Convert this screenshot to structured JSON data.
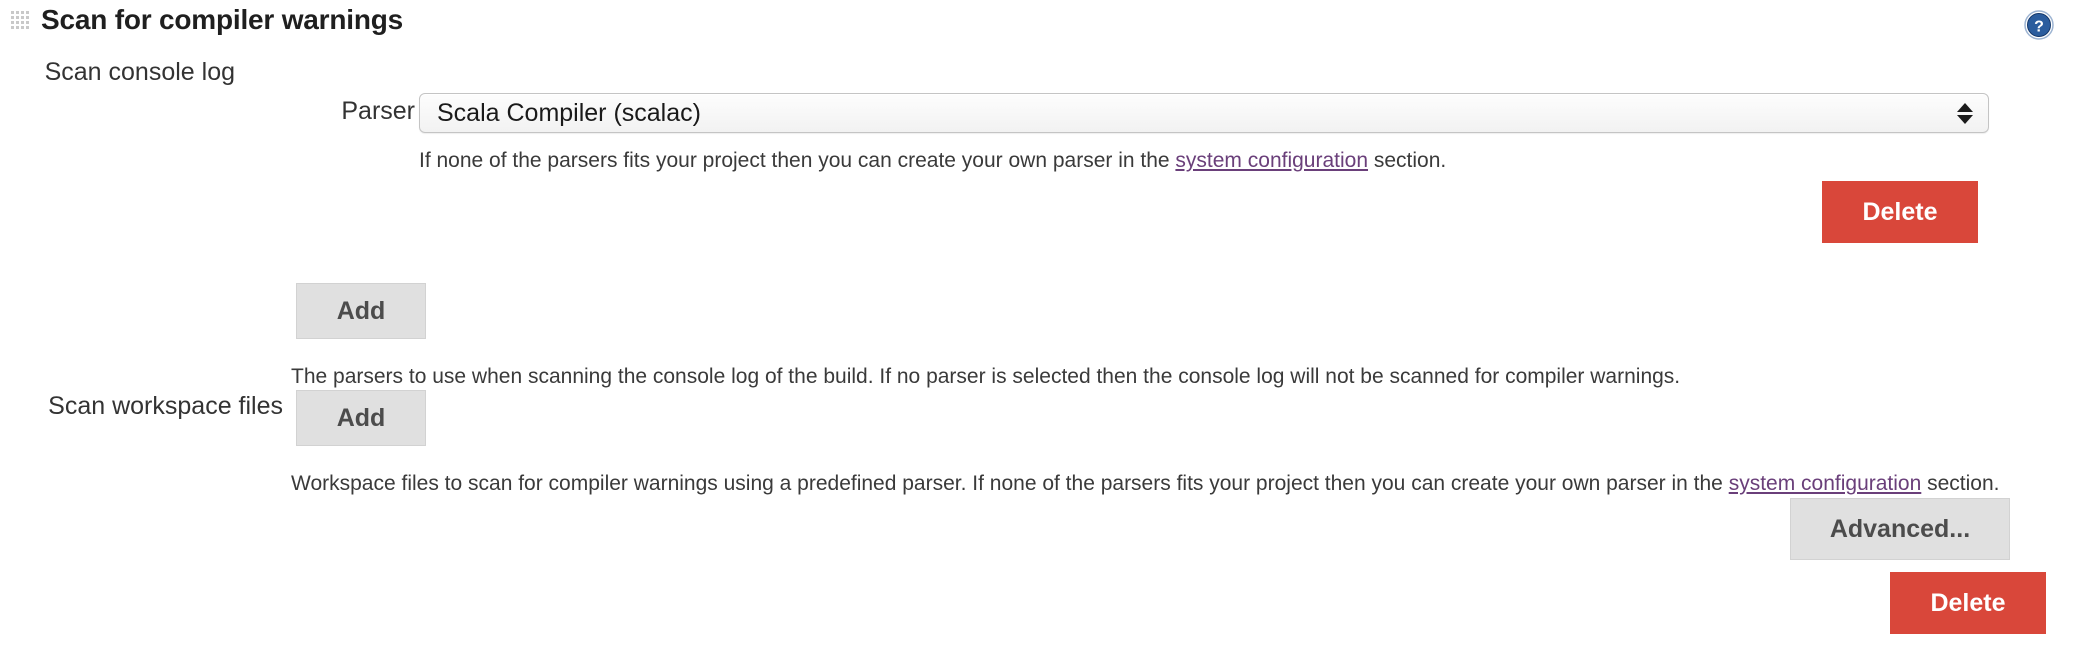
{
  "section": {
    "title": "Scan for compiler warnings",
    "drag_handle_icon": "drag-grip-icon",
    "help_icon": "help-circle-icon"
  },
  "rows": {
    "scan_console_log_label": "Scan console log",
    "scan_workspace_files_label": "Scan workspace files"
  },
  "parser": {
    "label": "Parser",
    "selected_value": "Scala Compiler (scalac)",
    "arrow_icon": "select-stepper-arrows-icon",
    "help": {
      "before_link": "If none of the parsers fits your project then you can create your own parser in the ",
      "link_text": "system configuration",
      "after_link": " section."
    }
  },
  "console_section": {
    "add_label": "Add",
    "help_text": "The parsers to use when scanning the console log of the build. If no parser is selected then the console log will not be scanned for compiler warnings.",
    "delete_label": "Delete"
  },
  "workspace_section": {
    "add_label": "Add",
    "help": {
      "before_link": "Workspace files to scan for compiler warnings using a predefined parser. If none of the parsers fits your project then you can create your own parser in the ",
      "link_text": "system configuration",
      "after_link": " section."
    },
    "advanced_label": "Advanced...",
    "delete_label": "Delete"
  },
  "colors": {
    "danger": "#d9473a",
    "button_grey": "#e0e0e0",
    "link": "#6a3f7a",
    "help_icon_blue": "#2b5d9e"
  }
}
